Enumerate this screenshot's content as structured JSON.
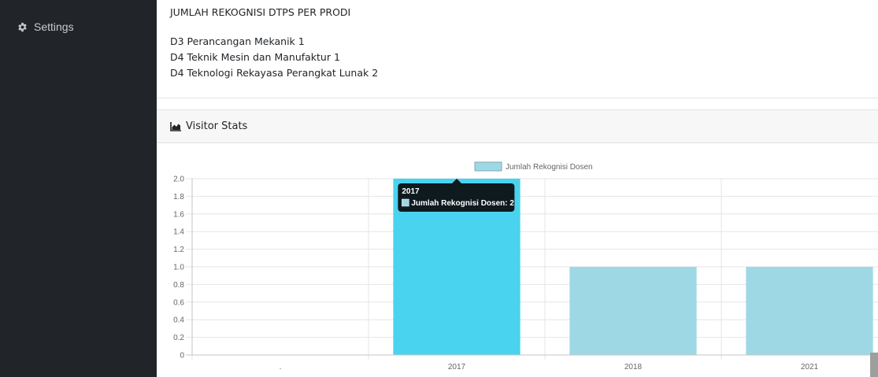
{
  "sidebar": {
    "items": [
      {
        "label": "Settings",
        "icon": "gear-icon"
      }
    ]
  },
  "info": {
    "title": "JUMLAH REKOGNISI DTPS PER PRODI",
    "lines": [
      "D3 Perancangan Mekanik 1",
      "D4 Teknik Mesin dan Manufaktur 1",
      "D4 Teknologi Rekayasa Perangkat Lunak 2"
    ]
  },
  "card": {
    "title": "Visitor Stats",
    "icon": "area-chart-icon"
  },
  "colors": {
    "bar": "#9fd8e5",
    "bar_active": "#4ad3ee",
    "sidebar": "#212529",
    "tooltip": "#0f1a1f"
  },
  "chart_data": {
    "type": "bar",
    "categories": [
      ".",
      "2017",
      "2018",
      "2021"
    ],
    "series": [
      {
        "name": "Jumlah Rekognisi Dosen",
        "values": [
          0,
          2,
          1,
          1
        ]
      }
    ],
    "ylim": [
      0,
      2
    ],
    "yticks": [
      "0",
      "0.2",
      "0.4",
      "0.6",
      "0.8",
      "1.0",
      "1.2",
      "1.4",
      "1.6",
      "1.8",
      "2.0"
    ],
    "legend": "top-center",
    "grid": true,
    "tooltip": {
      "title": "2017",
      "text": "Jumlah Rekognisi Dosen: 2",
      "category": "2017"
    }
  }
}
